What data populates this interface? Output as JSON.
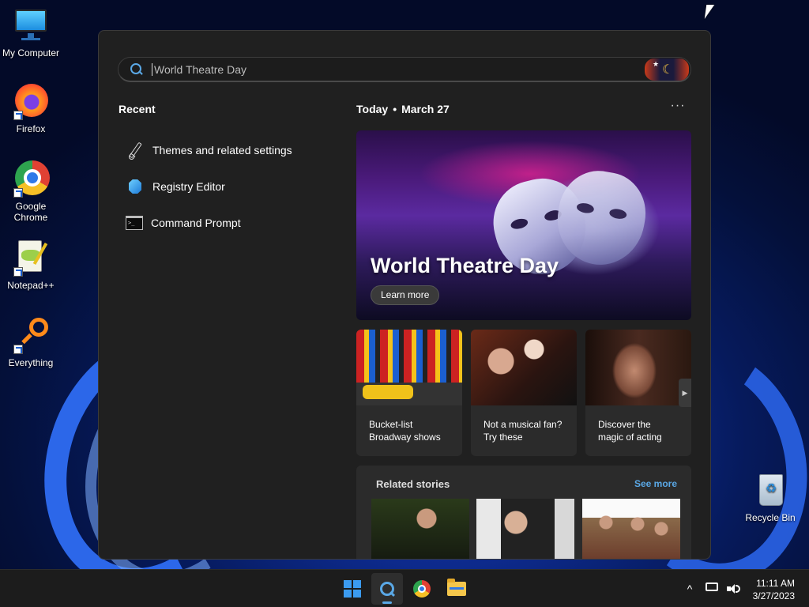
{
  "desktop": {
    "icons": [
      {
        "label": "My Computer"
      },
      {
        "label": "Firefox"
      },
      {
        "label": "Google Chrome"
      },
      {
        "label": "Notepad++"
      },
      {
        "label": "Everything"
      },
      {
        "label": "Recycle Bin"
      }
    ]
  },
  "search": {
    "query": "World Theatre Day",
    "placeholder": "World Theatre Day"
  },
  "recent": {
    "title": "Recent",
    "items": [
      {
        "label": "Themes and related settings",
        "icon": "brush-icon"
      },
      {
        "label": "Registry Editor",
        "icon": "registry-icon"
      },
      {
        "label": "Command Prompt",
        "icon": "cmd-icon"
      }
    ]
  },
  "today": {
    "label": "Today",
    "separator": "•",
    "date": "March 27",
    "more": "···"
  },
  "hero": {
    "title": "World Theatre Day",
    "button": "Learn more"
  },
  "cards": [
    {
      "line1": "Bucket-list",
      "line2": "Broadway shows"
    },
    {
      "line1": "Not a musical fan?",
      "line2": "Try these"
    },
    {
      "line1": "Discover the",
      "line2": "magic of acting"
    }
  ],
  "cards_next": "▶",
  "related": {
    "title": "Related stories",
    "see_more": "See more"
  },
  "taskbar": {
    "tray_chevron": "^",
    "time": "11:11 AM",
    "date": "3/27/2023"
  },
  "colors": {
    "accent": "#5aa8e6",
    "panel_bg": "#202020",
    "card_bg": "#2b2b2b"
  }
}
